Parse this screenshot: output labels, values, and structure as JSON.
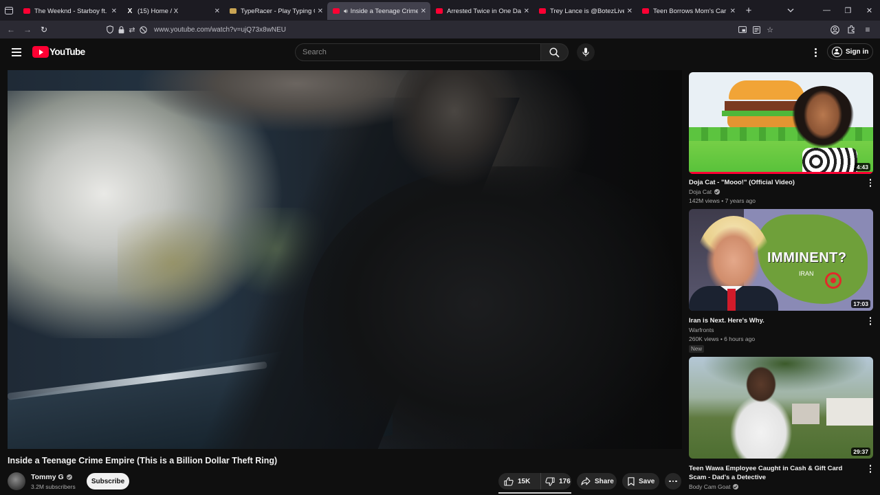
{
  "browser": {
    "tabs": [
      {
        "title": "The Weeknd - Starboy ft. Daft P",
        "favicon": "youtube-icon",
        "active": false,
        "audio": false
      },
      {
        "title": "(15) Home / X",
        "favicon": "x-icon",
        "active": false,
        "audio": false
      },
      {
        "title": "TypeRacer - Play Typing Games",
        "favicon": "typeracer-icon",
        "active": false,
        "audio": false
      },
      {
        "title": "Inside a Teenage Crime Em",
        "favicon": "youtube-icon",
        "active": true,
        "audio": true
      },
      {
        "title": "Arrested Twice in One Day. - Yo",
        "favicon": "youtube-icon",
        "active": false,
        "audio": false
      },
      {
        "title": "Trey Lance is @BotezLive C",
        "favicon": "youtube-icon",
        "active": false,
        "audio": false
      },
      {
        "title": "Teen Borrows Mom's Car & Ru",
        "favicon": "youtube-icon",
        "active": false,
        "audio": false
      }
    ],
    "url": "www.youtube.com/watch?v=ujQ73x8wNEU"
  },
  "youtube": {
    "logo_text": "YouTube",
    "search_placeholder": "Search",
    "signin_label": "Sign in"
  },
  "video": {
    "title": "Inside a Teenage Crime Empire (This is a Billion Dollar Theft Ring)",
    "channel": "Tommy G",
    "subscribers": "3.2M subscribers",
    "subscribe_label": "Subscribe",
    "likes": "15K",
    "dislikes": "176",
    "share_label": "Share",
    "save_label": "Save"
  },
  "related": [
    {
      "title": "Doja Cat - \"Mooo!\" (Official Video)",
      "channel": "Doja Cat",
      "verified": true,
      "meta": "142M views • 7 years ago",
      "duration": "4:43",
      "badge": "",
      "watched": 1.0
    },
    {
      "title": "Iran is Next. Here's Why.",
      "channel": "Warfronts",
      "verified": false,
      "meta": "260K views • 6 hours ago",
      "duration": "17:03",
      "badge": "New",
      "thumb_headline": "IMMINENT?",
      "thumb_sub": "IRAN",
      "watched": 0
    },
    {
      "title": "Teen Wawa Employee Caught in Cash & Gift Card Scam - Dad's a Detective",
      "channel": "Body Cam Goat",
      "verified": true,
      "meta": "",
      "duration": "29:37",
      "badge": "",
      "watched": 0
    }
  ],
  "colors": {
    "accent": "#ff0033",
    "background": "#0f0f0f",
    "tabstrip": "#1c1b22",
    "toolbar": "#2b2a33"
  }
}
